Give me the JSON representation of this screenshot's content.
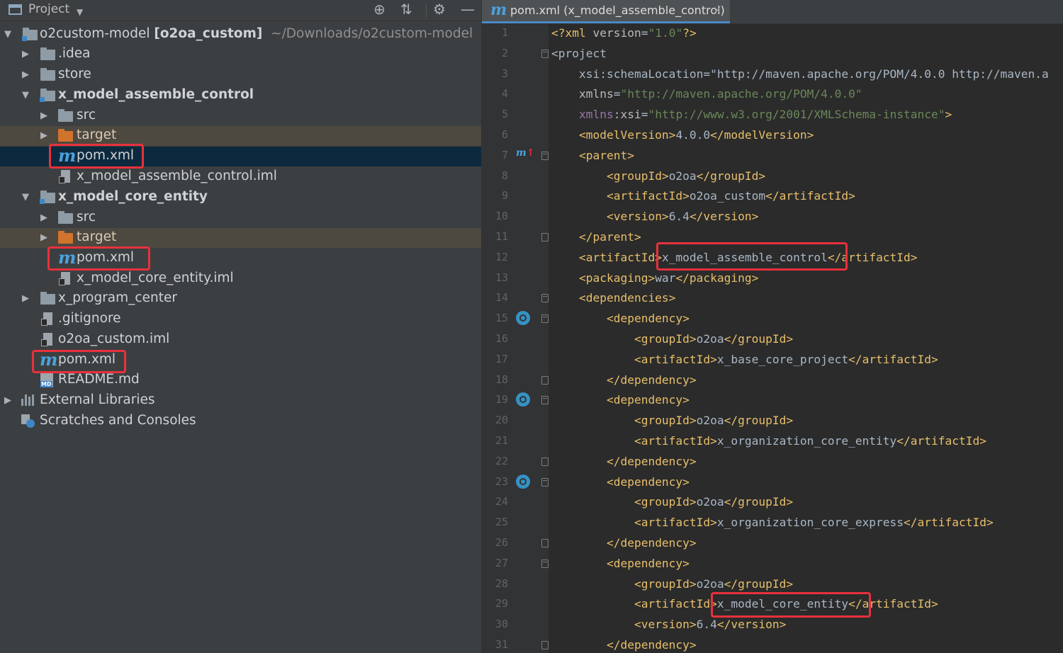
{
  "project_panel": {
    "title": "Project",
    "tree": [
      {
        "label": "o2custom-model",
        "module": "[o2oa_custom]",
        "path": "~/Downloads/o2custom-model",
        "icon": "module-folder-icon"
      },
      {
        "label": ".idea",
        "icon": "folder-icon"
      },
      {
        "label": "store",
        "icon": "folder-icon"
      },
      {
        "label": "x_model_assemble_control",
        "icon": "module-folder-icon"
      },
      {
        "label": "src",
        "icon": "folder-icon"
      },
      {
        "label": "target",
        "icon": "excluded-folder-icon"
      },
      {
        "label": "pom.xml",
        "icon": "maven-icon"
      },
      {
        "label": "x_model_assemble_control.iml",
        "icon": "iml-file-icon"
      },
      {
        "label": "x_model_core_entity",
        "icon": "module-folder-icon"
      },
      {
        "label": "src",
        "icon": "folder-icon"
      },
      {
        "label": "target",
        "icon": "excluded-folder-icon"
      },
      {
        "label": "pom.xml",
        "icon": "maven-icon"
      },
      {
        "label": "x_model_core_entity.iml",
        "icon": "iml-file-icon"
      },
      {
        "label": "x_program_center",
        "icon": "folder-icon"
      },
      {
        "label": ".gitignore",
        "icon": "gitignore-file-icon"
      },
      {
        "label": "o2oa_custom.iml",
        "icon": "iml-file-icon"
      },
      {
        "label": "pom.xml",
        "icon": "maven-icon"
      },
      {
        "label": "README.md",
        "icon": "markdown-file-icon"
      },
      {
        "label": "External Libraries",
        "icon": "library-icon"
      },
      {
        "label": "Scratches and Consoles",
        "icon": "scratch-icon"
      }
    ]
  },
  "editor": {
    "tab": {
      "icon_letter": "m",
      "label": "pom.xml (x_model_assemble_control)",
      "close": "×"
    },
    "lines": [
      {
        "n": "1",
        "code": "<?xml version=\"1.0\"?>"
      },
      {
        "n": "2",
        "code": "<project"
      },
      {
        "n": "3",
        "code": "    xsi:schemaLocation=\"http://maven.apache.org/POM/4.0.0 http://maven.a"
      },
      {
        "n": "4",
        "code": "    xmlns=\"http://maven.apache.org/POM/4.0.0\""
      },
      {
        "n": "5",
        "code": "    xmlns:xsi=\"http://www.w3.org/2001/XMLSchema-instance\">"
      },
      {
        "n": "6",
        "code": "    <modelVersion>4.0.0</modelVersion>"
      },
      {
        "n": "7",
        "code": "    <parent>"
      },
      {
        "n": "8",
        "code": "        <groupId>o2oa</groupId>"
      },
      {
        "n": "9",
        "code": "        <artifactId>o2oa_custom</artifactId>"
      },
      {
        "n": "10",
        "code": "        <version>6.4</version>"
      },
      {
        "n": "11",
        "code": "    </parent>"
      },
      {
        "n": "12",
        "code": "    <artifactId>x_model_assemble_control</artifactId>"
      },
      {
        "n": "13",
        "code": "    <packaging>war</packaging>"
      },
      {
        "n": "14",
        "code": "    <dependencies>"
      },
      {
        "n": "15",
        "code": "        <dependency>"
      },
      {
        "n": "16",
        "code": "            <groupId>o2oa</groupId>"
      },
      {
        "n": "17",
        "code": "            <artifactId>x_base_core_project</artifactId>"
      },
      {
        "n": "18",
        "code": "        </dependency>"
      },
      {
        "n": "19",
        "code": "        <dependency>"
      },
      {
        "n": "20",
        "code": "            <groupId>o2oa</groupId>"
      },
      {
        "n": "21",
        "code": "            <artifactId>x_organization_core_entity</artifactId>"
      },
      {
        "n": "22",
        "code": "        </dependency>"
      },
      {
        "n": "23",
        "code": "        <dependency>"
      },
      {
        "n": "24",
        "code": "            <groupId>o2oa</groupId>"
      },
      {
        "n": "25",
        "code": "            <artifactId>x_organization_core_express</artifactId>"
      },
      {
        "n": "26",
        "code": "        </dependency>"
      },
      {
        "n": "27",
        "code": "        <dependency>"
      },
      {
        "n": "28",
        "code": "            <groupId>o2oa</groupId>"
      },
      {
        "n": "29",
        "code": "            <artifactId>x_model_core_entity</artifactId>"
      },
      {
        "n": "30",
        "code": "            <version>6.4</version>"
      },
      {
        "n": "31",
        "code": "        </dependency>"
      }
    ]
  },
  "colors": {
    "accent": "#4a88c7",
    "highlight_box": "#e8313c",
    "selection": "#0d293e"
  }
}
